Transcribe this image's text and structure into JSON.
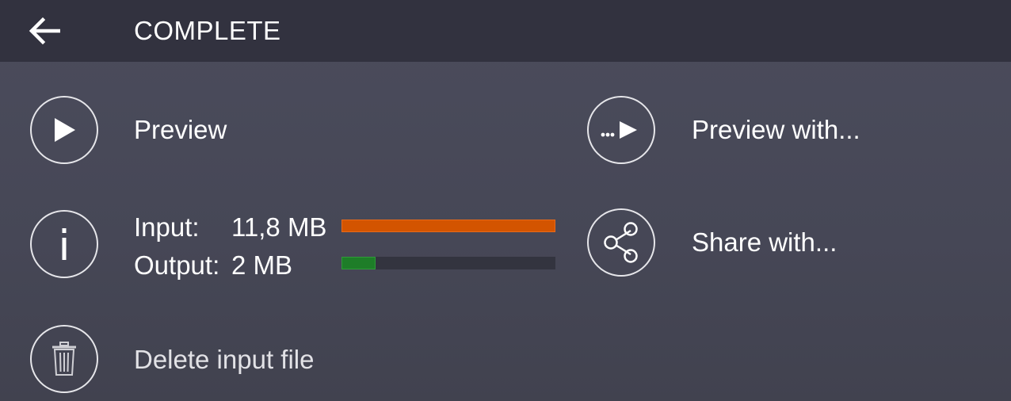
{
  "header": {
    "title": "COMPLETE"
  },
  "actions": {
    "preview": "Preview",
    "preview_with": "Preview with...",
    "share_with": "Share with...",
    "delete_input": "Delete input file"
  },
  "file_info": {
    "input_label": "Input:",
    "input_size": "11,8 MB",
    "input_fraction": 1.0,
    "output_label": "Output:",
    "output_size": "2 MB",
    "output_fraction": 0.16
  },
  "colors": {
    "topbar": "#32323f",
    "background": "#4a4b5a",
    "input_bar": "#d35400",
    "output_bar": "#1e7d28"
  }
}
